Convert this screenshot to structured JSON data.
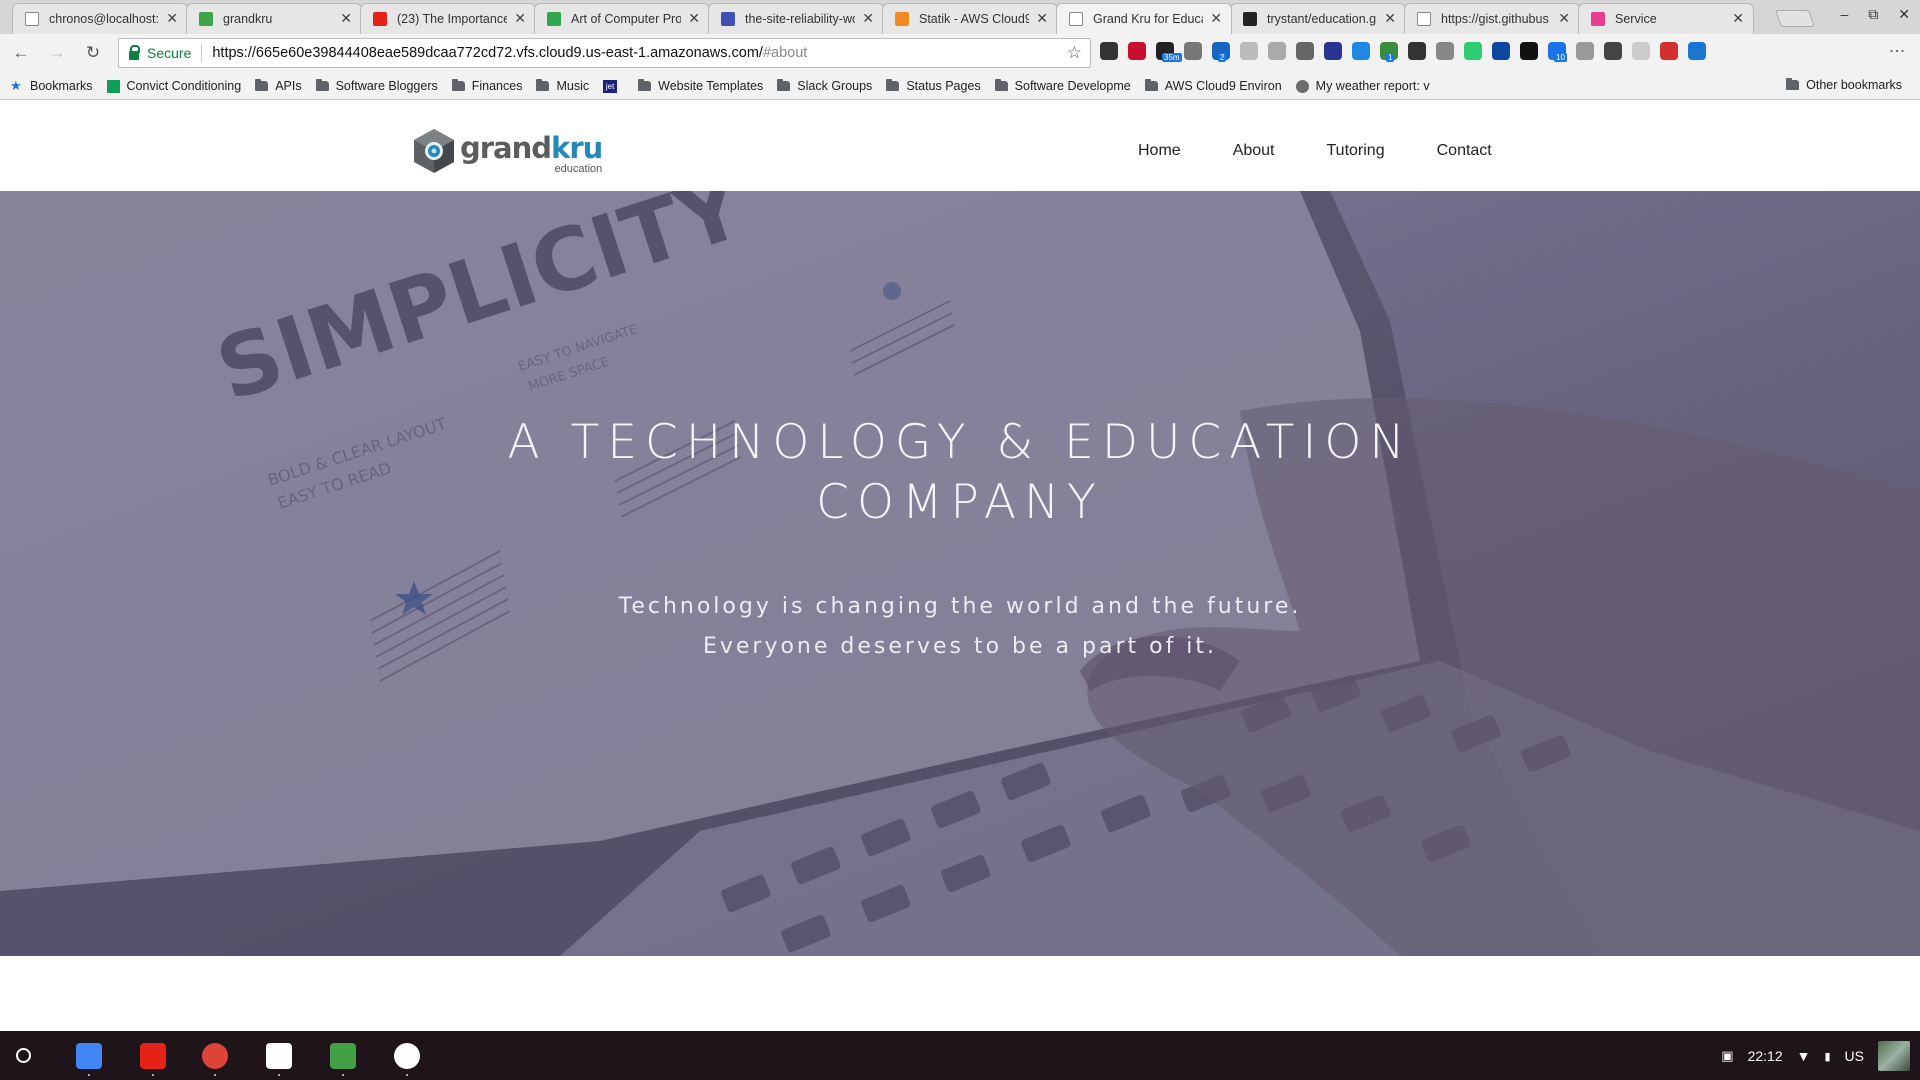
{
  "browser": {
    "tabs": [
      {
        "title": "chronos@localhost:/",
        "favicon_color": "#ffffff",
        "active": false
      },
      {
        "title": "grandkru",
        "favicon_color": "#3ea34b",
        "active": false
      },
      {
        "title": "(23) The Importance",
        "favicon_color": "#e62117",
        "active": false
      },
      {
        "title": "Art of Computer Prog",
        "favicon_color": "#2fa84f",
        "active": false
      },
      {
        "title": "the-site-reliability-wor",
        "favicon_color": "#3d51b0",
        "active": false
      },
      {
        "title": "Statik - AWS Cloud9",
        "favicon_color": "#f28a24",
        "active": false
      },
      {
        "title": "Grand Kru for Educat",
        "favicon_color": "#ffffff",
        "active": true
      },
      {
        "title": "trystant/education.g",
        "favicon_color": "#222222",
        "active": false
      },
      {
        "title": "https://gist.githubus",
        "favicon_color": "#ffffff",
        "active": false
      },
      {
        "title": "Service",
        "favicon_color": "#e93e8f",
        "active": false
      }
    ],
    "secure_label": "Secure",
    "url_host": "https://665e60e39844408eae589dcaa772cd72.vfs.cloud9.us-east-1.amazonaws.com/",
    "url_path": "#about",
    "extensions": [
      "#333333",
      "#c8102e",
      "#222222",
      "#777777",
      "#1565c0",
      "#bbbbbb",
      "#aaaaaa",
      "#666666",
      "#283593",
      "#1e88e5",
      "#388e3c",
      "#333333",
      "#888888",
      "#2ecc71",
      "#0d47a1",
      "#111111",
      "#1a73e8",
      "#999999",
      "#444444",
      "#cccccc",
      "#d32f2f",
      "#1976d2"
    ],
    "extension_badges": {
      "2": "35m",
      "4": "2",
      "10": "1",
      "16": "10"
    }
  },
  "bookmarks": {
    "items": [
      {
        "label": "Bookmarks",
        "type": "star"
      },
      {
        "label": "Convict Conditioning",
        "type": "sheet"
      },
      {
        "label": "APIs",
        "type": "folder"
      },
      {
        "label": "Software Bloggers",
        "type": "folder"
      },
      {
        "label": "Finances",
        "type": "folder"
      },
      {
        "label": "Music",
        "type": "folder"
      },
      {
        "label": "jet",
        "type": "tile"
      },
      {
        "label": "Website Templates",
        "type": "folder"
      },
      {
        "label": "Slack Groups",
        "type": "folder"
      },
      {
        "label": "Status Pages",
        "type": "folder"
      },
      {
        "label": "Software Developme",
        "type": "folder"
      },
      {
        "label": "AWS Cloud9 Environ",
        "type": "folder"
      },
      {
        "label": "My weather report: v",
        "type": "page"
      }
    ],
    "other": "Other bookmarks"
  },
  "site": {
    "logo_grand": "grand",
    "logo_kru": "kru",
    "logo_sub": "education",
    "nav": [
      "Home",
      "About",
      "Tutoring",
      "Contact"
    ],
    "hero_title_line1": "A TECHNOLOGY & EDUCATION",
    "hero_title_line2": "COMPANY",
    "hero_sub_line1": "Technology is changing the world and the future.",
    "hero_sub_line2": "Everyone deserves to be a part of it.",
    "photo_text": {
      "big": "SIMPLICITY",
      "left_1": "BOLD & CLEAR LAYOUT",
      "left_2": "EASY TO READ",
      "right_1": "EASY TO NAVIGATE",
      "right_2": "MORE SPACE"
    }
  },
  "shelf": {
    "apps": [
      {
        "name": "docs",
        "color": "#4285f4"
      },
      {
        "name": "youtube",
        "color": "#e62117"
      },
      {
        "name": "chrome",
        "color": "#db4437"
      },
      {
        "name": "play-store",
        "color": "#ffffff"
      },
      {
        "name": "android-app",
        "color": "#43a047"
      },
      {
        "name": "slack-s",
        "color": "#ffffff"
      }
    ],
    "time": "22:12",
    "locale": "US"
  }
}
